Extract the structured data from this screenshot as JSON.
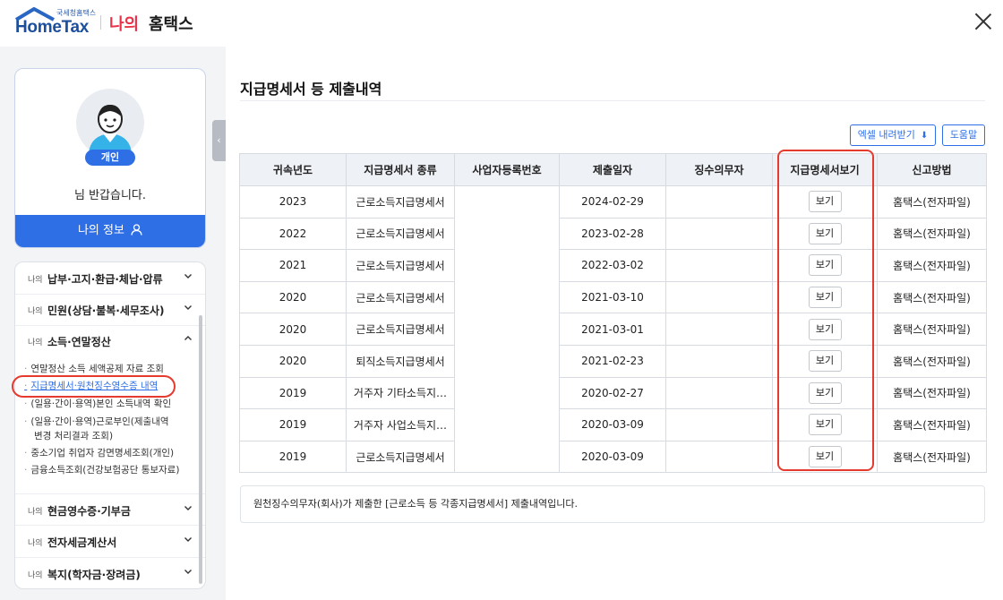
{
  "header": {
    "logo_sub": "국세청홈택스",
    "logo_main": "HomeTax",
    "my": "나의",
    "home": "홈택스"
  },
  "profile": {
    "badge": "개인",
    "greeting": "님 반갑습니다.",
    "my_info": "나의 정보"
  },
  "menu": {
    "prefix": "나의",
    "items": [
      {
        "label": "납부·고지·환급·체납·압류"
      },
      {
        "label": "민원(상담·불복·세무조사)"
      },
      {
        "label": "소득·연말정산"
      },
      {
        "label": "현금영수증·기부금"
      },
      {
        "label": "전자세금계산서"
      },
      {
        "label": "복지(학자금·장려금)"
      }
    ],
    "subitems": [
      {
        "label": "연말정산 소득 세액공제 자료 조회"
      },
      {
        "label": "지급명세서·원천징수영수증 내역"
      },
      {
        "label": "(일용·간이·용역)본인 소득내역 확인"
      },
      {
        "label": "(일용·간이·용역)근로부인(제출내역"
      },
      {
        "label": "변경 처리결과 조회)"
      },
      {
        "label": "중소기업 취업자 감면명세조회(개인)"
      },
      {
        "label": "금융소득조회(건강보험공단 통보자료)"
      }
    ]
  },
  "main": {
    "title": "지급명세서 등 제출내역",
    "excel_button": "엑셀 내려받기",
    "help_button": "도움말",
    "columns": [
      "귀속년도",
      "지급명세서 종류",
      "사업자등록번호",
      "제출일자",
      "징수의무자",
      "지급명세서보기",
      "신고방법"
    ],
    "view_label": "보기",
    "rows": [
      {
        "year": "2023",
        "type": "근로소득지급명세서",
        "date": "2024-02-29",
        "method": "홈택스(전자파일)"
      },
      {
        "year": "2022",
        "type": "근로소득지급명세서",
        "date": "2023-02-28",
        "method": "홈택스(전자파일)"
      },
      {
        "year": "2021",
        "type": "근로소득지급명세서",
        "date": "2022-03-02",
        "method": "홈택스(전자파일)"
      },
      {
        "year": "2020",
        "type": "근로소득지급명세서",
        "date": "2021-03-10",
        "method": "홈택스(전자파일)"
      },
      {
        "year": "2020",
        "type": "근로소득지급명세서",
        "date": "2021-03-01",
        "method": "홈택스(전자파일)"
      },
      {
        "year": "2020",
        "type": "퇴직소득지급명세서",
        "date": "2021-02-23",
        "method": "홈택스(전자파일)"
      },
      {
        "year": "2019",
        "type": "거주자 기타소득지…",
        "date": "2020-02-27",
        "method": "홈택스(전자파일)"
      },
      {
        "year": "2019",
        "type": "거주자 사업소득지…",
        "date": "2020-03-09",
        "method": "홈택스(전자파일)"
      },
      {
        "year": "2019",
        "type": "근로소득지급명세서",
        "date": "2020-03-09",
        "method": "홈택스(전자파일)"
      }
    ],
    "info_text": "원천징수의무자(회사)가 제출한 [근로소득 등 각종지급명세서] 제출내역입니다."
  },
  "colors": {
    "accent": "#2f6fe6",
    "brand_red": "#e8334a",
    "highlight": "#e63a2e"
  }
}
